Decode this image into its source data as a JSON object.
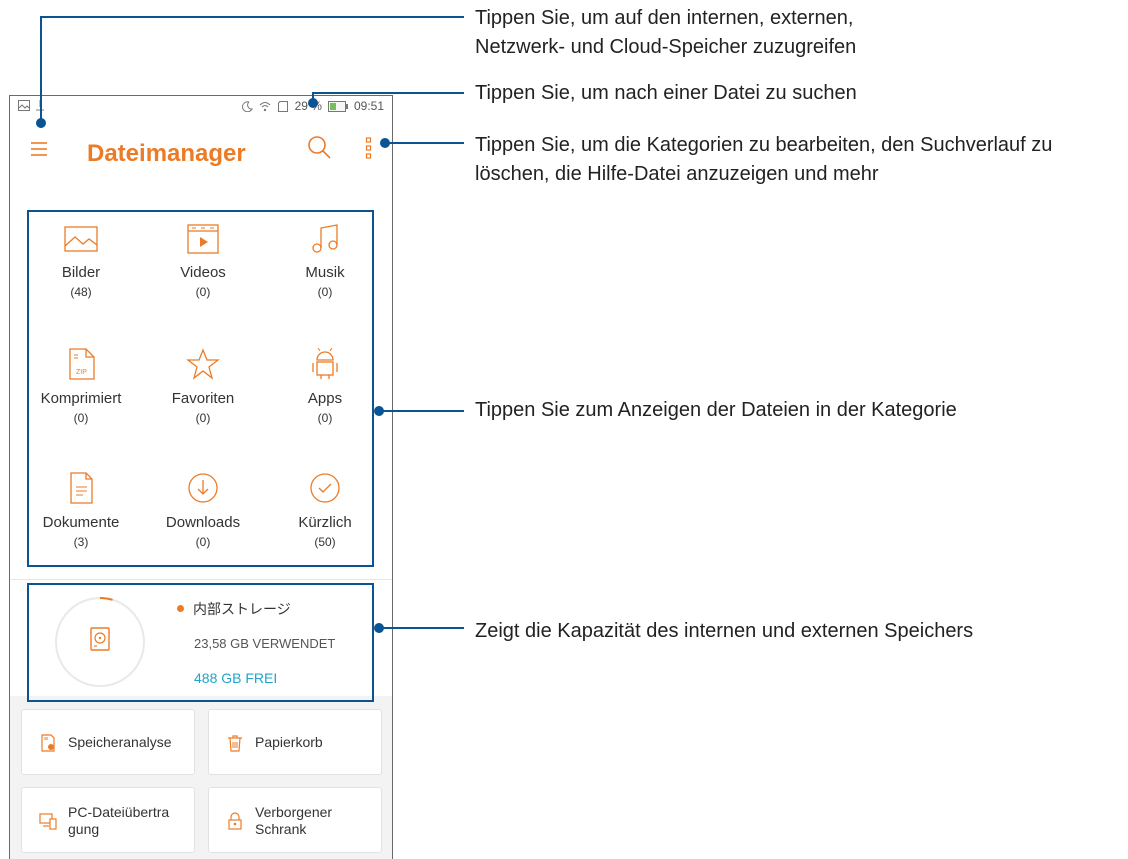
{
  "app": {
    "title": "Dateimanager",
    "colors": {
      "accent": "#ec7b27",
      "free": "#1fa6c9",
      "annotation": "#0a5494"
    }
  },
  "statusbar": {
    "battery": "29 %",
    "time": "09:51",
    "icons": [
      "gallery-notification-icon",
      "download-notification-icon",
      "alarm-icon",
      "wifi-icon",
      "sd-card-icon",
      "battery-icon"
    ]
  },
  "toolbar": {
    "menu_icon": "hamburger-menu-icon",
    "search_icon": "search-icon",
    "more_icon": "more-vertical-icon"
  },
  "categories": [
    {
      "label": "Bilder",
      "count": "(48)",
      "icon": "image-icon"
    },
    {
      "label": "Videos",
      "count": "(0)",
      "icon": "video-icon"
    },
    {
      "label": "Musik",
      "count": "(0)",
      "icon": "music-icon"
    },
    {
      "label": "Komprimiert",
      "count": "(0)",
      "icon": "zip-icon"
    },
    {
      "label": "Favoriten",
      "count": "(0)",
      "icon": "star-icon"
    },
    {
      "label": "Apps",
      "count": "(0)",
      "icon": "android-icon"
    },
    {
      "label": "Dokumente",
      "count": "(3)",
      "icon": "document-icon"
    },
    {
      "label": "Downloads",
      "count": "(0)",
      "icon": "download-icon"
    },
    {
      "label": "Kürzlich",
      "count": "(50)",
      "icon": "recent-check-icon"
    }
  ],
  "storage": {
    "name": "内部ストレージ",
    "used": "23,58 GB VERWENDET",
    "free": "488 GB FREI",
    "used_fraction": 0.046
  },
  "tools": [
    {
      "label": "Speicheranalyse",
      "icon": "storage-analysis-icon"
    },
    {
      "label": "Papierkorb",
      "icon": "trash-icon"
    },
    {
      "label": "PC-Dateiübertra gung",
      "icon": "pc-transfer-icon"
    },
    {
      "label": "Verborgener Schrank",
      "icon": "lock-icon"
    }
  ],
  "annotations": [
    {
      "line1": "Tippen Sie, um auf den internen, externen,",
      "line2": "Netzwerk- und Cloud-Speicher zuzugreifen"
    },
    {
      "line1": "Tippen Sie, um nach einer Datei zu suchen"
    },
    {
      "line1": "Tippen Sie, um die Kategorien zu bearbeiten, den Suchverlauf zu",
      "line2": "löschen, die Hilfe-Datei anzuzeigen und mehr"
    },
    {
      "line1": "Tippen Sie zum Anzeigen der Dateien in der Kategorie"
    },
    {
      "line1": "Zeigt die Kapazität des internen und externen Speichers"
    }
  ]
}
